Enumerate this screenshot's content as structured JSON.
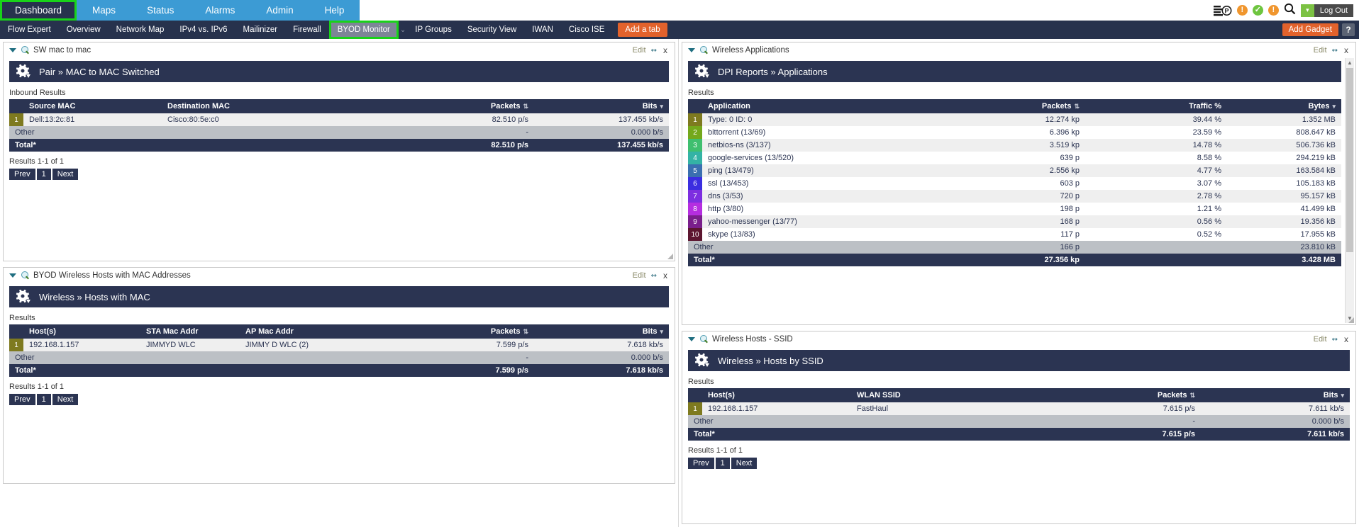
{
  "topnav": {
    "items": [
      {
        "label": "Dashboard",
        "active": true
      },
      {
        "label": "Maps",
        "active": false
      },
      {
        "label": "Status",
        "active": false
      },
      {
        "label": "Alarms",
        "active": false
      },
      {
        "label": "Admin",
        "active": false
      },
      {
        "label": "Help",
        "active": false
      }
    ],
    "icons": [
      {
        "name": "p-report-icon",
        "glyph": "P"
      },
      {
        "name": "alert-warning-icon",
        "glyph": "!",
        "color": "#f0962e"
      },
      {
        "name": "status-ok-icon",
        "glyph": "✓",
        "color": "#6ec53f"
      },
      {
        "name": "alert-warning-icon-2",
        "glyph": "!",
        "color": "#f0962e"
      },
      {
        "name": "search-icon",
        "glyph": "⚲"
      }
    ],
    "logout_label": "Log Out",
    "logout_caret": "▾"
  },
  "tabbar": {
    "tabs": [
      {
        "label": "Flow Expert",
        "active": false
      },
      {
        "label": "Overview",
        "active": false
      },
      {
        "label": "Network Map",
        "active": false
      },
      {
        "label": "IPv4 vs. IPv6",
        "active": false
      },
      {
        "label": "Mailinizer",
        "active": false
      },
      {
        "label": "Firewall",
        "active": false
      },
      {
        "label": "BYOD Monitor",
        "active": true
      },
      {
        "label": "IP Groups",
        "active": false
      },
      {
        "label": "Security View",
        "active": false
      },
      {
        "label": "IWAN",
        "active": false
      },
      {
        "label": "Cisco ISE",
        "active": false
      }
    ],
    "separator": "⌄",
    "add_tab_label": "Add a tab",
    "add_gadget_label": "Add Gadget",
    "help_label": "?"
  },
  "gadget_common": {
    "edit_label": "Edit",
    "edit_arrows": "↭",
    "close_label": "x",
    "results_label": "Results",
    "other_label": "Other",
    "total_label": "Total*",
    "prev_label": "Prev",
    "page_label": "1",
    "next_label": "Next",
    "sort_both": "⇅",
    "sort_desc": "▾"
  },
  "gadgets": [
    {
      "id": "sw-mac-to-mac",
      "title": "SW mac to mac",
      "report_title": "Pair » MAC to MAC Switched",
      "results_label": "Inbound Results",
      "columns": [
        "",
        "Source MAC",
        "Destination MAC",
        "Packets",
        "Bits"
      ],
      "rows": [
        {
          "rank": "1",
          "rank_color": "#7e7a1f",
          "cells": [
            "Dell:13:2c:81",
            "Cisco:80:5e:c0",
            "82.510 p/s",
            "137.455 kb/s"
          ]
        }
      ],
      "other": {
        "label": "Other",
        "cells": [
          "",
          "",
          "-",
          "0.000 b/s"
        ]
      },
      "total": {
        "label": "Total*",
        "cells": [
          "",
          "",
          "82.510 p/s",
          "137.455 kb/s"
        ]
      },
      "pager_text": "Results 1-1 of 1"
    },
    {
      "id": "byod-wireless-hosts-mac",
      "title": "BYOD Wireless Hosts with MAC Addresses",
      "report_title": "Wireless » Hosts with MAC",
      "results_label": "Results",
      "columns": [
        "",
        "Host(s)",
        "STA Mac Addr",
        "AP Mac Addr",
        "Packets",
        "Bits"
      ],
      "rows": [
        {
          "rank": "1",
          "rank_color": "#7e7a1f",
          "cells": [
            "192.168.1.157",
            "JIMMYD WLC",
            "JIMMY D WLC (2)",
            "7.599 p/s",
            "7.618 kb/s"
          ]
        }
      ],
      "other": {
        "label": "Other",
        "cells": [
          "",
          "",
          "",
          "-",
          "0.000 b/s"
        ]
      },
      "total": {
        "label": "Total*",
        "cells": [
          "",
          "",
          "",
          "7.599 p/s",
          "7.618 kb/s"
        ]
      },
      "pager_text": "Results 1-1 of 1"
    },
    {
      "id": "wireless-applications",
      "title": "Wireless Applications",
      "report_title": "DPI Reports » Applications",
      "results_label": "Results",
      "columns": [
        "",
        "Application",
        "Packets",
        "Traffic %",
        "Bytes"
      ],
      "rows": [
        {
          "rank": "1",
          "rank_color": "#7e7a1f",
          "cells": [
            "Type: 0 ID: 0",
            "12.274 kp",
            "39.44 %",
            "1.352 MB"
          ]
        },
        {
          "rank": "2",
          "rank_color": "#74a81c",
          "cells": [
            "bittorrent (13/69)",
            "6.396 kp",
            "23.59 %",
            "808.647 kB"
          ]
        },
        {
          "rank": "3",
          "rank_color": "#3fbf6f",
          "cells": [
            "netbios-ns (3/137)",
            "3.519 kp",
            "14.78 %",
            "506.736 kB"
          ]
        },
        {
          "rank": "4",
          "rank_color": "#34b3a5",
          "cells": [
            "google-services (13/520)",
            "639 p",
            "8.58 %",
            "294.219 kB"
          ]
        },
        {
          "rank": "5",
          "rank_color": "#3a6fb0",
          "cells": [
            "ping (13/479)",
            "2.556 kp",
            "4.77 %",
            "163.584 kB"
          ]
        },
        {
          "rank": "6",
          "rank_color": "#3b2ee0",
          "cells": [
            "ssl (13/453)",
            "603 p",
            "3.07 %",
            "105.183 kB"
          ]
        },
        {
          "rank": "7",
          "rank_color": "#7d2ee0",
          "cells": [
            "dns (3/53)",
            "720 p",
            "2.78 %",
            "95.157 kB"
          ]
        },
        {
          "rank": "8",
          "rank_color": "#b52ee0",
          "cells": [
            "http (3/80)",
            "198 p",
            "1.21 %",
            "41.499 kB"
          ]
        },
        {
          "rank": "9",
          "rank_color": "#7a1f8c",
          "cells": [
            "yahoo-messenger (13/77)",
            "168 p",
            "0.56 %",
            "19.356 kB"
          ]
        },
        {
          "rank": "10",
          "rank_color": "#5c1630",
          "cells": [
            "skype (13/83)",
            "117 p",
            "0.52 %",
            "17.955 kB"
          ]
        }
      ],
      "other": {
        "label": "Other",
        "cells": [
          "",
          "166 p",
          "",
          "23.810 kB"
        ]
      },
      "total": {
        "label": "Total*",
        "cells": [
          "",
          "27.356 kp",
          "",
          "3.428 MB"
        ]
      }
    },
    {
      "id": "wireless-hosts-ssid",
      "title": "Wireless Hosts - SSID",
      "report_title": "Wireless » Hosts by SSID",
      "results_label": "Results",
      "columns": [
        "",
        "Host(s)",
        "WLAN SSID",
        "Packets",
        "Bits"
      ],
      "rows": [
        {
          "rank": "1",
          "rank_color": "#7e7a1f",
          "cells": [
            "192.168.1.157",
            "FastHaul",
            "7.615 p/s",
            "7.611 kb/s"
          ]
        }
      ],
      "other": {
        "label": "Other",
        "cells": [
          "",
          "",
          "-",
          "0.000 b/s"
        ]
      },
      "total": {
        "label": "Total*",
        "cells": [
          "",
          "",
          "7.615 p/s",
          "7.611 kb/s"
        ]
      },
      "pager_text": "Results 1-1 of 1"
    }
  ],
  "colors": {
    "nav_blue": "#3c9bd4",
    "dark_navy": "#2b3452",
    "orange": "#e2622c",
    "green_highlight": "#19d219"
  }
}
